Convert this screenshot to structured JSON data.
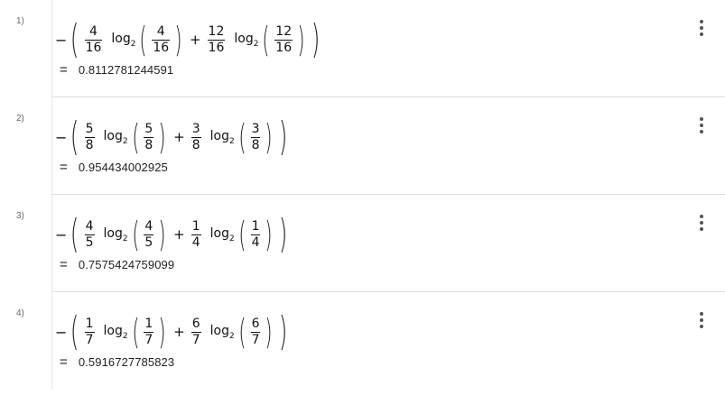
{
  "rows": [
    {
      "index": "1)",
      "neg": "−",
      "log_label": "log",
      "log_base": "2",
      "plus": "+",
      "frac_a_num": "4",
      "frac_a_den": "16",
      "frac_b_num": "12",
      "frac_b_den": "16",
      "equals": "=",
      "result": "0.8112781244591"
    },
    {
      "index": "2)",
      "neg": "−",
      "log_label": "log",
      "log_base": "2",
      "plus": "+",
      "frac_a_num": "5",
      "frac_a_den": "8",
      "frac_b_num": "3",
      "frac_b_den": "8",
      "equals": "=",
      "result": "0.954434002925"
    },
    {
      "index": "3)",
      "neg": "−",
      "log_label": "log",
      "log_base": "2",
      "plus": "+",
      "frac_a_num": "4",
      "frac_a_den": "5",
      "frac_b_num": "1",
      "frac_b_den": "4",
      "equals": "=",
      "result": "0.7575424759099"
    },
    {
      "index": "4)",
      "neg": "−",
      "log_label": "log",
      "log_base": "2",
      "plus": "+",
      "frac_a_num": "1",
      "frac_a_den": "7",
      "frac_b_num": "6",
      "frac_b_den": "7",
      "equals": "=",
      "result": "0.5916727785823"
    }
  ],
  "icons": {
    "row_menu": "more-vertical-icon"
  }
}
